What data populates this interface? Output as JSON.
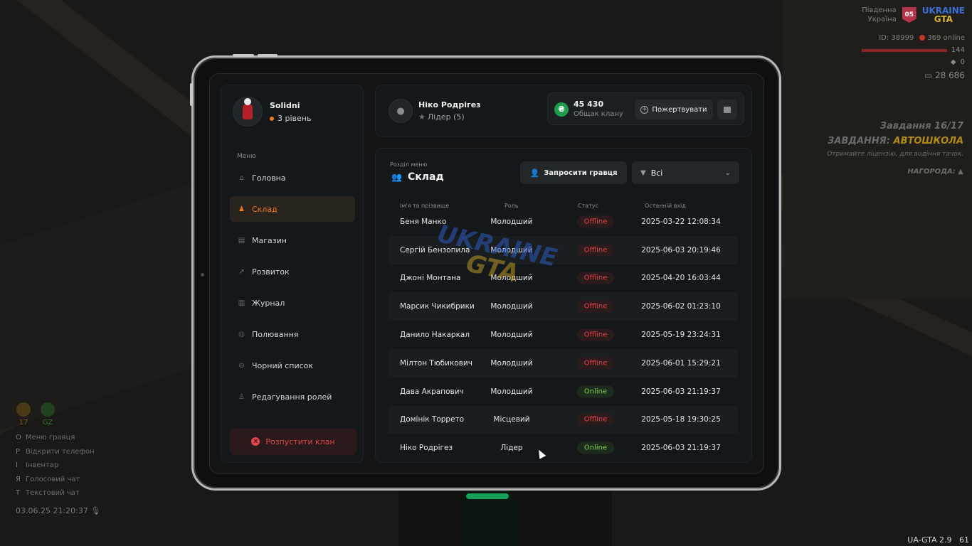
{
  "hud": {
    "region_line1": "Південна",
    "region_line2": "Україна",
    "region_badge": "05",
    "logo_top": "UKRAINE",
    "logo_bottom": "GTA",
    "player_id": "ID: 38999",
    "online": "369 online",
    "health": "144",
    "armor": "0",
    "money": "28 686",
    "task_header": "Завдання 16/17",
    "task_label": "ЗАВДАННЯ:",
    "task_name": "АВТОШКОЛА",
    "task_desc": "Отримайте ліцензію, для водіння тачок.",
    "reward_label": "НАГОРОДА:",
    "hunger": "17",
    "thirst": "GZ",
    "keys": [
      {
        "key": "O",
        "label": "Меню гравця"
      },
      {
        "key": "P",
        "label": "Відкрити телефон"
      },
      {
        "key": "I",
        "label": "Інвентар"
      },
      {
        "key": "Я",
        "label": "Голосовий чат"
      },
      {
        "key": "T",
        "label": "Текстовий чат"
      }
    ],
    "datetime": "03.06.25 21:20:37",
    "version": "UA-GTA 2.9",
    "fps": "61"
  },
  "profile": {
    "name": "Solidni",
    "level": "3 рівень"
  },
  "menu": {
    "caption": "Меню",
    "items": [
      {
        "label": "Головна",
        "icon": "home-icon"
      },
      {
        "label": "Склад",
        "icon": "people-icon"
      },
      {
        "label": "Магазин",
        "icon": "basket-icon"
      },
      {
        "label": "Розвиток",
        "icon": "chart-icon"
      },
      {
        "label": "Журнал",
        "icon": "book-icon"
      },
      {
        "label": "Полювання",
        "icon": "target-icon"
      },
      {
        "label": "Чорний список",
        "icon": "block-icon"
      },
      {
        "label": "Редагування ролей",
        "icon": "user-edit-icon"
      }
    ],
    "active_index": 1,
    "disband_label": "Розпустити клан"
  },
  "leader": {
    "name": "Ніко Родрігез",
    "role": "Лідер (5)"
  },
  "bank": {
    "amount": "45 430",
    "caption": "Общак клану",
    "coin_symbol": "₴",
    "donate_label": "Пожертвувати"
  },
  "section": {
    "caption": "Розділ меню",
    "title": "Склад",
    "invite_label": "Запросити гравця",
    "filter_value": "Всі"
  },
  "table": {
    "headers": [
      "Ім'я та прізвище",
      "Роль",
      "Статус",
      "Останній вхід"
    ],
    "rows": [
      {
        "name": "Беня Манко",
        "role": "Молодший",
        "status": "Offline",
        "last": "2025-03-22 12:08:34"
      },
      {
        "name": "Сергій Бензопила",
        "role": "Молодший",
        "status": "Offline",
        "last": "2025-06-03 20:19:46"
      },
      {
        "name": "Джоні Монтана",
        "role": "Молодший",
        "status": "Offline",
        "last": "2025-04-20 16:03:44"
      },
      {
        "name": "Марсик Чикибрики",
        "role": "Молодший",
        "status": "Offline",
        "last": "2025-06-02 01:23:10"
      },
      {
        "name": "Данило Накаркал",
        "role": "Молодший",
        "status": "Offline",
        "last": "2025-05-19 23:24:31"
      },
      {
        "name": "Мілтон Тюбикович",
        "role": "Молодший",
        "status": "Offline",
        "last": "2025-06-01 15:29:21"
      },
      {
        "name": "Дава Акрапович",
        "role": "Молодший",
        "status": "Online",
        "last": "2025-06-03 21:19:37"
      },
      {
        "name": "Домінік Торрето",
        "role": "Місцевий",
        "status": "Offline",
        "last": "2025-05-18 19:30:25"
      },
      {
        "name": "Ніко Родрігез",
        "role": "Лідер",
        "status": "Online",
        "last": "2025-06-03 21:19:37"
      }
    ]
  },
  "watermark": {
    "line1": "UKRAINE",
    "line2": "GTA"
  },
  "colors": {
    "accent": "#f07a1a",
    "offline": "#e2454b",
    "online": "#7fd24a",
    "coin": "#1e9e4d"
  }
}
